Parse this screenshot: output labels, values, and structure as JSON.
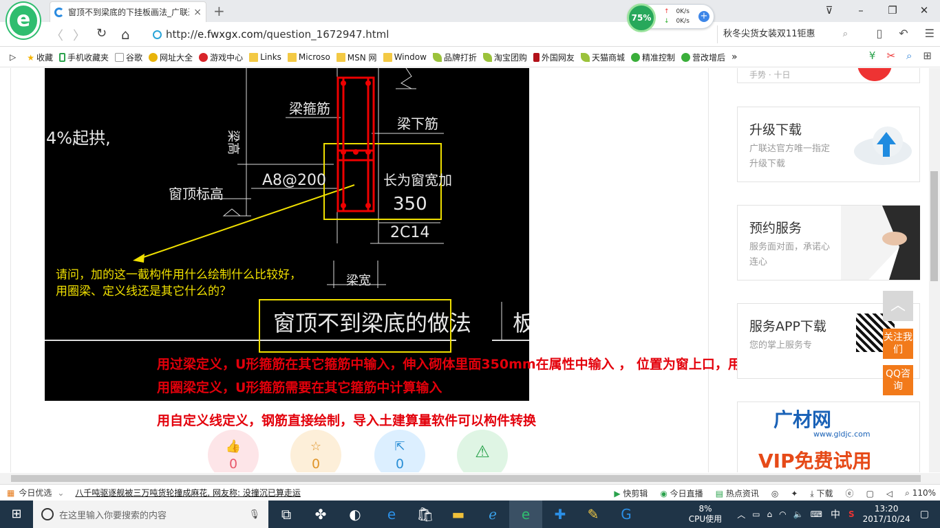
{
  "browser": {
    "tab_title": "窗顶不到梁底的下挂板画法_广联达",
    "close_tab": "×",
    "new_tab": "+",
    "window_controls": [
      "⊽",
      "–",
      "❐",
      "✕"
    ],
    "speed": {
      "percent": "75%",
      "up": "0K/s",
      "down": "0K/s",
      "plus": "+"
    },
    "nav": {
      "back": "〈",
      "forward": "〉",
      "refresh": "↻",
      "home": "⌂"
    },
    "url_prefix": "http://",
    "url_host": "e.fwxgx.com",
    "url_path": "/question_1672947.html",
    "search_text": "秋冬尖货女装双11钜惠",
    "search_icon": "⌕",
    "right_tools": [
      "▯",
      "↶",
      "☰"
    ]
  },
  "favorites": {
    "toggle": "▷",
    "items": [
      {
        "label": "收藏",
        "icon": "star-icon"
      },
      {
        "label": "手机收藏夹",
        "icon": "phone-icon"
      },
      {
        "label": "谷歌",
        "icon": "page-icon"
      },
      {
        "label": "网址大全",
        "icon": "globe-icon"
      },
      {
        "label": "游戏中心",
        "icon": "game-icon"
      },
      {
        "label": "Links",
        "icon": "folder-icon"
      },
      {
        "label": "Microso",
        "icon": "folder-icon"
      },
      {
        "label": "MSN 网",
        "icon": "folder-icon"
      },
      {
        "label": "Window",
        "icon": "folder-icon"
      },
      {
        "label": "品牌打折",
        "icon": "leaf-icon"
      },
      {
        "label": "淘宝团购",
        "icon": "leaf-icon"
      },
      {
        "label": "外国网友",
        "icon": "flag-icon"
      },
      {
        "label": "天猫商城",
        "icon": "leaf-icon"
      },
      {
        "label": "精准控制",
        "icon": "chat-icon"
      },
      {
        "label": "营改增后",
        "icon": "chat-icon"
      }
    ],
    "more": "»",
    "tools": [
      "¥",
      "✂",
      "⌕",
      "⊞"
    ]
  },
  "question_image": {
    "annotation_4pct": "4%起拱,",
    "label_stirrup": "梁箍筋",
    "label_height": "梁高",
    "label_bottom_bar": "梁下筋",
    "label_a8": "A8@200",
    "label_width_plus": "长为窗宽加",
    "label_350": "350",
    "label_window_elev": "窗顶标高",
    "label_2c14": "2C14",
    "label_beam_width": "梁宽",
    "question_line1": "请问，加的这一截构件用什么绘制什么比较好，",
    "question_line2": "用圈梁、定义线还是其它什么的？",
    "title_method": "窗顶不到梁底的做法",
    "title_cut": "板"
  },
  "answer": {
    "line1": "用过梁定义，U形箍筋在其它箍筋中输入，伸入砌体里面350mm在属性中输入 ， 位置为窗上口，用点画制",
    "line2": "用圈梁定义，U形箍筋需要在其它箍筋中计算输入",
    "line3": "用自定义线定义，钢筋直接绘制，导入土建算量软件可以构件转换"
  },
  "actions": [
    {
      "name": "like",
      "icon": "👍",
      "count": "0",
      "color": "#e85a6c",
      "bg": "#fde5e8"
    },
    {
      "name": "favorite",
      "icon": "☆",
      "count": "0",
      "color": "#e0952a",
      "bg": "#fdefd9"
    },
    {
      "name": "share",
      "icon": "⇱",
      "count": "0",
      "color": "#2b8fd6",
      "bg": "#dcefff"
    },
    {
      "name": "report",
      "icon": "⚠",
      "count": "",
      "color": "#2aa24c",
      "bg": "#dff5e4"
    }
  ],
  "sidebar": {
    "top_card_text": "手势 · 十日",
    "upgrade": {
      "title": "升级下载",
      "sub": "广联达官方唯一指定升级下载"
    },
    "appointment": {
      "title": "预约服务",
      "sub": "服务面对面，承诺心连心"
    },
    "app": {
      "title": "服务APP下载",
      "sub": "您的掌上服务专"
    },
    "ad": {
      "brand": "广材网",
      "site": "www.gldjc.com",
      "vip": "VIP免费试用"
    }
  },
  "float": {
    "top": "︿",
    "follow": "关注我们",
    "qq": "QQ咨询"
  },
  "statusbar": {
    "today": "今日优选",
    "news": "八千吨驱逐舰被三万吨货轮撞成麻花, 网友称: 没撞沉已算走运",
    "items": [
      "快剪辑",
      "今日直播",
      "热点资讯"
    ],
    "download": "下载",
    "zoom": "110%"
  },
  "taskbar": {
    "search_placeholder": "在这里输入你要搜索的内容",
    "cpu_pct": "8%",
    "cpu_label": "CPU使用",
    "ime": "中",
    "time": "13:20",
    "date": "2017/10/24"
  },
  "colors": {
    "accent_red": "#e3000b",
    "cad_yellow": "#f0e000",
    "orange": "#f27a1a"
  }
}
